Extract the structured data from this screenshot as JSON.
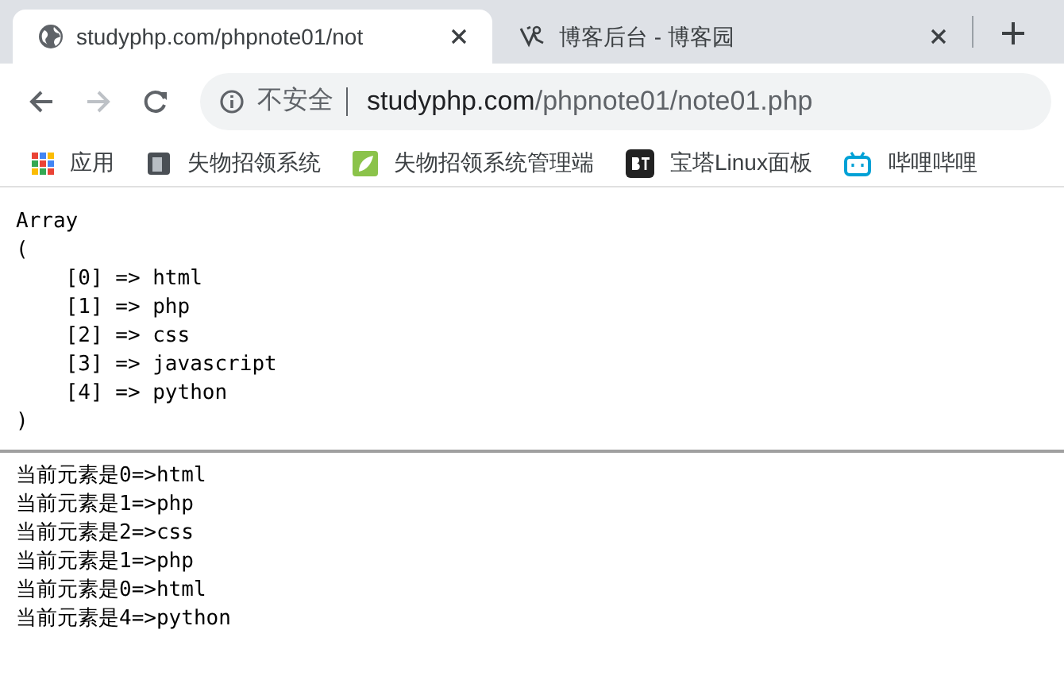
{
  "tabs": [
    {
      "title": "studyphp.com/phpnote01/not",
      "kind": "globe",
      "selected": true
    },
    {
      "title": "博客后台 - 博客园",
      "kind": "blog",
      "selected": false
    }
  ],
  "address_bar": {
    "security": "不安全",
    "host": "studyphp.com",
    "path": "/phpnote01/note01.php"
  },
  "bookmarks": [
    {
      "label": "应用",
      "kind": "apps"
    },
    {
      "label": "失物招领系统",
      "kind": "page"
    },
    {
      "label": "失物招领系统管理端",
      "kind": "leaf"
    },
    {
      "label": "宝塔Linux面板",
      "kind": "bt"
    },
    {
      "label": "哔哩哔哩",
      "kind": "tv"
    }
  ],
  "array_dump": [
    "Array",
    "(",
    "    [0] => html",
    "    [1] => php",
    "    [2] => css",
    "    [3] => javascript",
    "    [4] => python",
    ")"
  ],
  "output_lines": [
    "当前元素是0=>html",
    "当前元素是1=>php",
    "当前元素是2=>css",
    "当前元素是1=>php",
    "当前元素是0=>html",
    "当前元素是4=>python"
  ]
}
